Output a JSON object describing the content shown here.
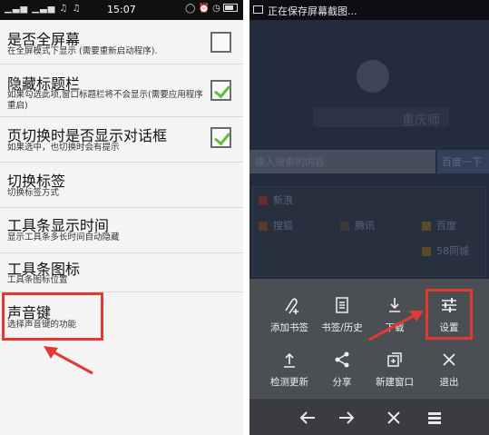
{
  "left": {
    "status": {
      "time": "15:07"
    },
    "settings": [
      {
        "title": "是否全屏幕",
        "subtitle": "在全屏模式下显示 (需要重新启动程序).",
        "checked": false
      },
      {
        "title": "隐藏标题栏",
        "subtitle": "如果勾选此项,窗口标题栏将不会显示(需要应用程序重启)",
        "checked": true
      },
      {
        "title": "页切换时是否显示对话框",
        "subtitle": "如果选中，也切换时会有提示",
        "checked": true
      },
      {
        "title": "切换标签",
        "subtitle": "切换标签方式"
      },
      {
        "title": "工具条显示时间",
        "subtitle": "显示工具条多长时间自动隐藏"
      },
      {
        "title": "工具条图标",
        "subtitle": "工具条图标位置"
      },
      {
        "title": "声音键",
        "subtitle": "选择声音键的功能"
      }
    ]
  },
  "right": {
    "notification": "正在保存屏幕截图...",
    "background": {
      "logo": "重庆师",
      "search_placeholder": "输入搜索的内容",
      "search_button": "百度一下",
      "nav": [
        "新浪",
        "搜狐",
        "腾讯",
        "百度",
        "58同城"
      ]
    },
    "menu": {
      "row1": [
        "添加书签",
        "书签/历史",
        "下载",
        "设置"
      ],
      "row2": [
        "检测更新",
        "分享",
        "新建窗口",
        "退出"
      ]
    }
  },
  "colors": {
    "annotation_red": "#e23a32",
    "check_green": "#5fbf3a",
    "menu_bg": "#4b4e53"
  }
}
